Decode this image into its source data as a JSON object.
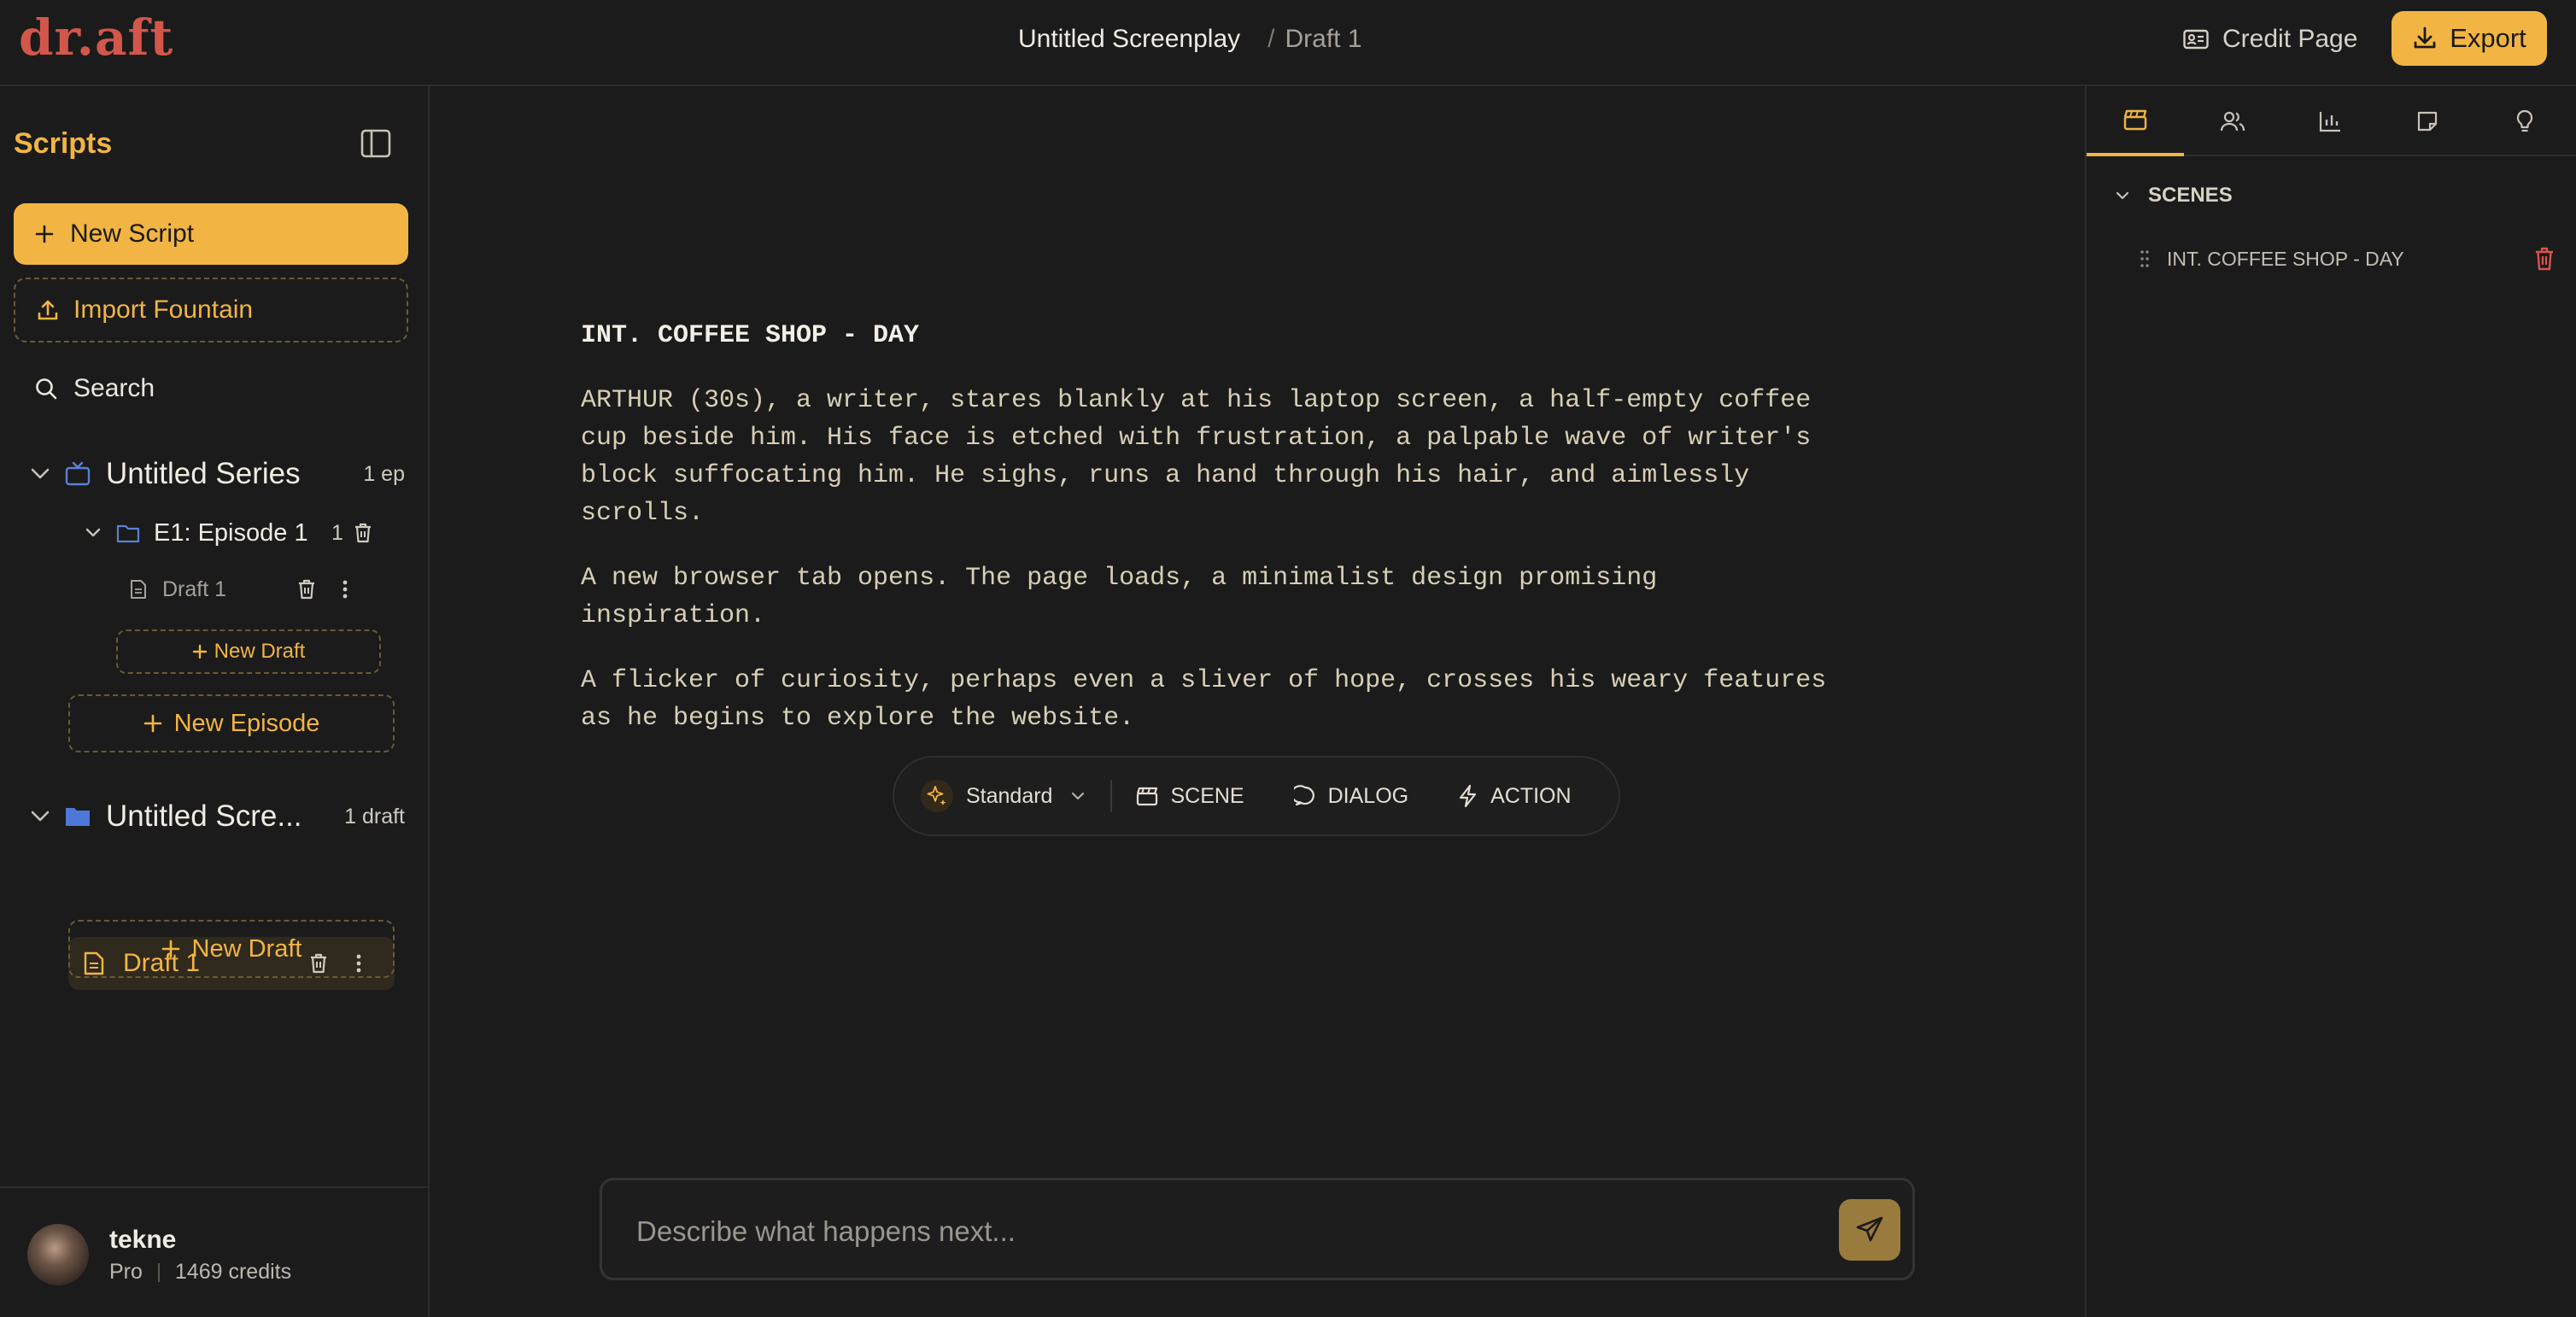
{
  "app": {
    "logo": "dr.aft",
    "colors": {
      "accent": "#f2b543",
      "logo": "#d2574a",
      "background": "#1b1b1b",
      "danger": "#d9534f"
    }
  },
  "header": {
    "title": "Untitled Screenplay",
    "separator": "/",
    "draft": "Draft 1",
    "credit_page": "Credit Page",
    "export": "Export"
  },
  "sidebar": {
    "title": "Scripts",
    "new_script": "New Script",
    "import_fountain": "Import Fountain",
    "search": "Search",
    "series": {
      "name": "Untitled Series",
      "count": "1 ep",
      "episode": {
        "name": "E1: Episode 1",
        "count": "1",
        "draft": "Draft 1",
        "new_draft": "New Draft"
      },
      "new_episode": "New Episode"
    },
    "screenplay": {
      "name": "Untitled Scre...",
      "count": "1 draft",
      "draft": "Draft 1",
      "new_draft": "New Draft"
    },
    "user": {
      "name": "tekne",
      "plan": "Pro",
      "credits": "1469 credits"
    }
  },
  "editor": {
    "slugline": "INT. COFFEE SHOP - DAY",
    "paragraphs": [
      "ARTHUR (30s), a writer, stares blankly at his laptop screen, a half-empty coffee\ncup beside him. His face is etched with frustration, a palpable wave of writer's\nblock suffocating him. He sighs, runs a hand through his hair, and aimlessly\nscrolls.",
      "A new browser tab opens. The page loads, a minimalist design promising\ninspiration.",
      "A flicker of curiosity, perhaps even a sliver of hope, crosses his weary features\nas he begins to explore the website."
    ],
    "toolbar": {
      "mode": "Standard",
      "scene": "SCENE",
      "dialog": "DIALOG",
      "action": "ACTION"
    },
    "prompt_placeholder": "Describe what happens next..."
  },
  "right_panel": {
    "tabs": [
      "scenes-icon",
      "characters-icon",
      "stats-icon",
      "notes-icon",
      "ideas-icon"
    ],
    "scenes_heading": "SCENES",
    "scenes": [
      "INT. COFFEE SHOP - DAY"
    ]
  }
}
